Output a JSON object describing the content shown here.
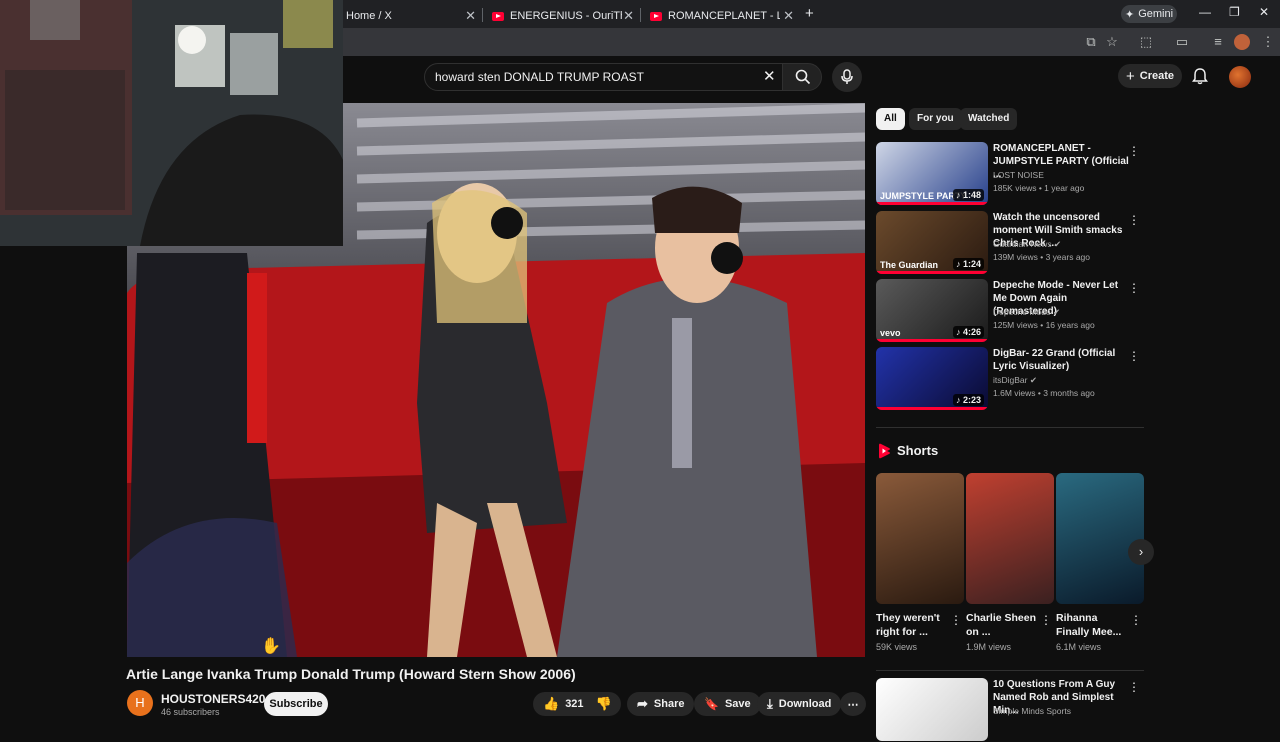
{
  "browser": {
    "tabs": [
      {
        "label": "Home / X"
      },
      {
        "label": "ENERGENIUS - OuriTheKid (Offi"
      },
      {
        "label": "ROMANCEPLANET - LEAVE TO"
      }
    ],
    "new_tab": "+",
    "gemini": "Gemini"
  },
  "youtube": {
    "search_query": "howard sten DONALD TRUMP ROAST",
    "create_label": "Create"
  },
  "video": {
    "title": "Artie Lange Ivanka Trump Donald Trump (Howard Stern Show 2006)",
    "channel_initial": "H",
    "channel_name": "HOUSTONERS420",
    "subscribers": "46 subscribers",
    "subscribe_label": "Subscribe",
    "likes": "321",
    "share_label": "Share",
    "save_label": "Save",
    "download_label": "Download",
    "more_label": "⋯"
  },
  "filters": [
    "All",
    "For you",
    "Watched"
  ],
  "recommendations": [
    {
      "title": "ROMANCEPLANET - JUMPSTYLE PARTY (Official ...",
      "channel": "LOST NOISE",
      "meta": "185K views • 1 year ago",
      "duration": "1:48",
      "verified": false,
      "colors": [
        "#cfd6e6",
        "#27408b"
      ],
      "overlay": "JUMPSTYLE PARTY"
    },
    {
      "title": "Watch the uncensored moment Will Smith smacks Chris Rock ...",
      "channel": "Guardian News",
      "meta": "139M views • 3 years ago",
      "duration": "1:24",
      "verified": true,
      "colors": [
        "#6b4a2c",
        "#2a1a10"
      ],
      "overlay": "The Guardian"
    },
    {
      "title": "Depeche Mode - Never Let Me Down Again (Remastered)",
      "channel": "Depeche Mode",
      "meta": "125M views • 16 years ago",
      "duration": "4:26",
      "verified": true,
      "colors": [
        "#5a5a5a",
        "#1a1a1a"
      ],
      "overlay": "vevo"
    },
    {
      "title": "DigBar- 22 Grand (Official Lyric Visualizer)",
      "channel": "itsDigBar",
      "meta": "1.6M views • 3 months ago",
      "duration": "2:23",
      "verified": true,
      "colors": [
        "#2233aa",
        "#0a0a30"
      ],
      "overlay": ""
    },
    {
      "title": "10 Questions From A Guy Named Rob and Simplest Min...",
      "channel": "Simple Minds Sports",
      "meta": "",
      "duration": "",
      "verified": false,
      "colors": [
        "#ffffff",
        "#cccccc"
      ],
      "overlay": ""
    }
  ],
  "shorts": {
    "heading": "Shorts",
    "items": [
      {
        "title": "They weren't right for ...",
        "views": "59K views",
        "colors": [
          "#8a5a3a",
          "#2a1a10"
        ]
      },
      {
        "title": "Charlie Sheen on ...",
        "views": "1.9M views",
        "colors": [
          "#c04030",
          "#3a2020"
        ]
      },
      {
        "title": "Rihanna Finally Mee...",
        "views": "6.1M views",
        "colors": [
          "#2a6a80",
          "#0a1a2a"
        ]
      }
    ]
  }
}
